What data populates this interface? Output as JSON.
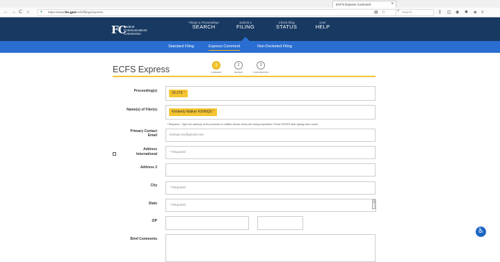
{
  "browser": {
    "tab_title": "ECFS Express Comment",
    "tab_close": "×",
    "url_prefix": "https://www.",
    "url_domain": "fcc.gov",
    "url_path": "/ecfs/filings/express",
    "search_placeholder": "Search",
    "nav": {
      "back": "←",
      "forward": "→",
      "reload": "C",
      "home": "⌂"
    }
  },
  "fcc_header": {
    "logo": "FC",
    "logo_text": [
      "Federal",
      "Communications",
      "Commission"
    ],
    "nav": [
      {
        "small": "Filings & Proceedings",
        "big": "SEARCH"
      },
      {
        "small": "Submit a",
        "big": "FILING"
      },
      {
        "small": "Check filing",
        "big": "STATUS"
      },
      {
        "small": "User",
        "big": "HELP"
      }
    ]
  },
  "subnav": {
    "items": [
      "Standard Filing",
      "Express Comment",
      "Non-Docketed Filing"
    ]
  },
  "page": {
    "title": "ECFS Express",
    "steps": [
      {
        "number": "1",
        "label": "COMMENT"
      },
      {
        "number": "2",
        "label": "REVIEW"
      },
      {
        "number": "3",
        "label": "CONFIRMATION"
      }
    ]
  },
  "form": {
    "proceeding_label": "Proceeding(s)",
    "proceeding_value": "20-276",
    "filers_label": "Name(s) of Filer(s)",
    "filers_value": "Kimberly Walker KXIINQS",
    "required_star": "*",
    "filers_help": "* Required - Type the name(s) of the persons or entities whose views are being expressed. Press ENTER after typing each name.",
    "email_label_1": "Primary Contact",
    "email_label_2": "Email",
    "email_value": "kxiinqs.mv@gmail.com",
    "address_label": "Address",
    "international_label": "International",
    "address_placeholder": "* Required",
    "address2_label": "Address 2",
    "city_label": "City",
    "city_placeholder": "* Required",
    "state_label": "State",
    "state_placeholder": "* Required",
    "zip_label": "ZIP",
    "comments_label": "Brief Comments"
  }
}
